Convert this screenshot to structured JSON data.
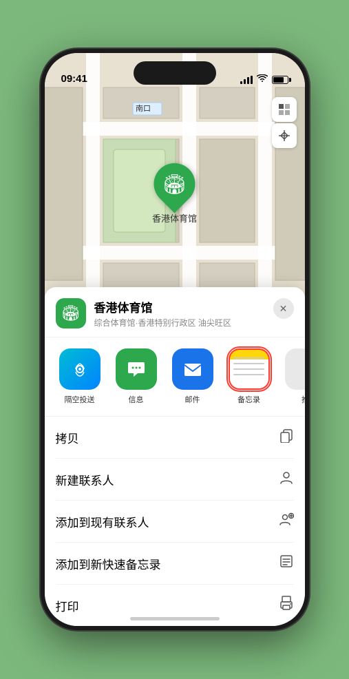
{
  "status": {
    "time": "09:41",
    "location_arrow": "▶"
  },
  "map": {
    "label": "南口",
    "station_name": "香港体育馆",
    "pin_emoji": "🏟"
  },
  "location_card": {
    "name": "香港体育馆",
    "description": "综合体育馆·香港特别行政区 油尖旺区",
    "close_label": "✕"
  },
  "share_items": [
    {
      "label": "隔空投送",
      "type": "airdrop"
    },
    {
      "label": "信息",
      "type": "messages"
    },
    {
      "label": "邮件",
      "type": "mail"
    },
    {
      "label": "备忘录",
      "type": "notes"
    },
    {
      "label": "推",
      "type": "more"
    }
  ],
  "actions": [
    {
      "label": "拷贝",
      "icon": "copy"
    },
    {
      "label": "新建联系人",
      "icon": "person"
    },
    {
      "label": "添加到现有联系人",
      "icon": "person-add"
    },
    {
      "label": "添加到新快速备忘录",
      "icon": "memo"
    },
    {
      "label": "打印",
      "icon": "print"
    }
  ]
}
